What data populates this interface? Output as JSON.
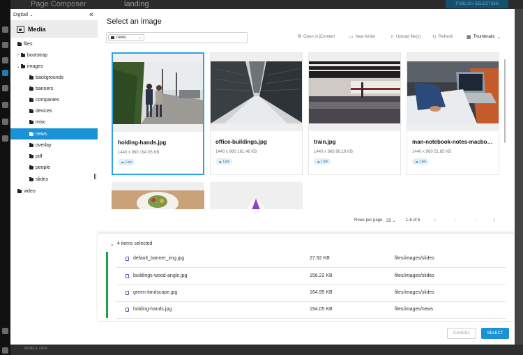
{
  "background": {
    "app_title": "Page Composer",
    "page_name": "landing",
    "publish_label": "PUBLISH SELECTION",
    "footer_text": "MOBILE VIEW"
  },
  "tree": {
    "workspace": "Digitall",
    "collapse_glyph": "«",
    "heading": "Media",
    "nodes": [
      {
        "label": "files",
        "chevron": ""
      },
      {
        "label": "bootstrap",
        "chevron": "›"
      },
      {
        "label": "images",
        "chevron": "⌄"
      },
      {
        "label": "backgrounds",
        "chevron": ""
      },
      {
        "label": "banners",
        "chevron": ""
      },
      {
        "label": "companies",
        "chevron": ""
      },
      {
        "label": "devices",
        "chevron": ""
      },
      {
        "label": "misc",
        "chevron": ""
      },
      {
        "label": "news",
        "chevron": ""
      },
      {
        "label": "overlay",
        "chevron": ""
      },
      {
        "label": "pdf",
        "chevron": ""
      },
      {
        "label": "people",
        "chevron": ""
      },
      {
        "label": "slides",
        "chevron": ""
      },
      {
        "label": "video",
        "chevron": ""
      }
    ],
    "selected": "news"
  },
  "dialog": {
    "title": "Select an image",
    "path_value": "news",
    "toolbar": {
      "open_jcontent": "Open in jContent",
      "new_folder": "New folder",
      "upload": "Upload file(s)",
      "refresh": "Refresh",
      "view_mode": "Thumbnails"
    }
  },
  "cards": [
    {
      "name": "holding-hands.jpg",
      "meta": "1440 x 960   194.05 KB",
      "badge": "Live",
      "selected": true
    },
    {
      "name": "office-buildings.jpg",
      "meta": "1440 x 960   161.46 KB",
      "badge": "Live",
      "selected": false
    },
    {
      "name": "train.jpg",
      "meta": "1440 x 966   98.19 KB",
      "badge": "Live",
      "selected": false
    },
    {
      "name": "man-notebook-notes-macbo…",
      "meta": "1440 x 960   51.85 KB",
      "badge": "Live",
      "selected": false
    }
  ],
  "pagination": {
    "rows_label": "Rows per page",
    "rows_value": "25",
    "range": "1-6 of 6"
  },
  "selection": {
    "header": "4 items selected",
    "items": [
      {
        "name": "default_banner_img.jpg",
        "size": "27.92 KB",
        "path": "files/images/slides"
      },
      {
        "name": "buildings-wood-angle.jpg",
        "size": "156.22 KB",
        "path": "files/images/slides"
      },
      {
        "name": "green-landscape.jpg",
        "size": "164.95 KB",
        "path": "files/images/slides"
      },
      {
        "name": "holding-hands.jpg",
        "size": "194.05 KB",
        "path": "files/images/news"
      }
    ]
  },
  "buttons": {
    "cancel": "CANCEL",
    "select": "SELECT"
  },
  "colors": {
    "accent": "#1a93d6",
    "selection_bar": "#1aa34a",
    "live_badge_bg": "#dff0fb"
  }
}
